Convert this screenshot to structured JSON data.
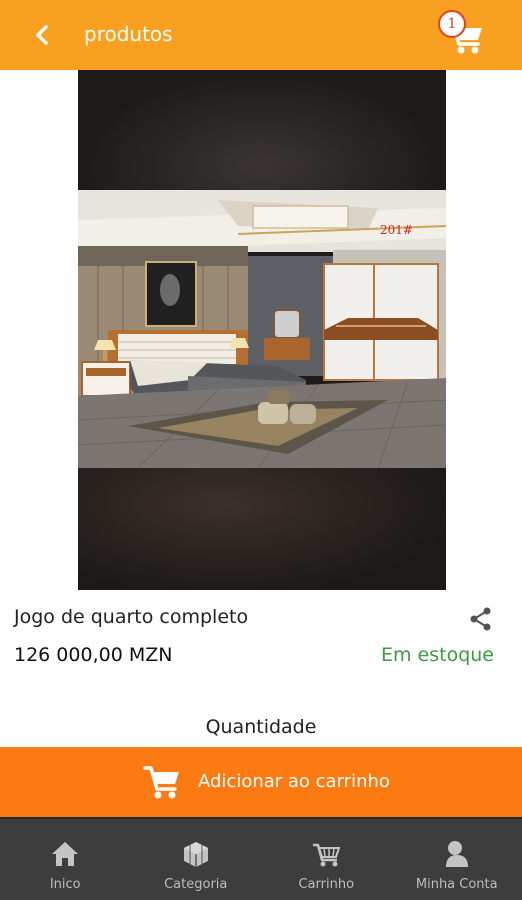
{
  "header": {
    "title": "produtos",
    "back_icon": "chevron-left-icon",
    "cart_icon": "cart-icon",
    "cart_badge": "1"
  },
  "product": {
    "name": "Jogo de quarto completo",
    "price": "126 000,00 MZN",
    "stock_status": "Em estoque",
    "image_label": "201#",
    "share_icon": "share-icon"
  },
  "quantity": {
    "label": "Quantidade"
  },
  "add_to_cart": {
    "label": "Adicionar ao carrinho",
    "icon": "cart-icon"
  },
  "bottom_nav": {
    "items": [
      {
        "label": "Inico",
        "icon": "home-icon"
      },
      {
        "label": "Categoria",
        "icon": "cube-icon"
      },
      {
        "label": "Carrinho",
        "icon": "basket-icon"
      },
      {
        "label": "Minha Conta",
        "icon": "user-icon"
      }
    ]
  },
  "colors": {
    "header_bg": "#f9a020",
    "button_bg": "#fb7a12",
    "nav_bg": "#3d3d3d",
    "stock_green": "#3c9a3f"
  }
}
